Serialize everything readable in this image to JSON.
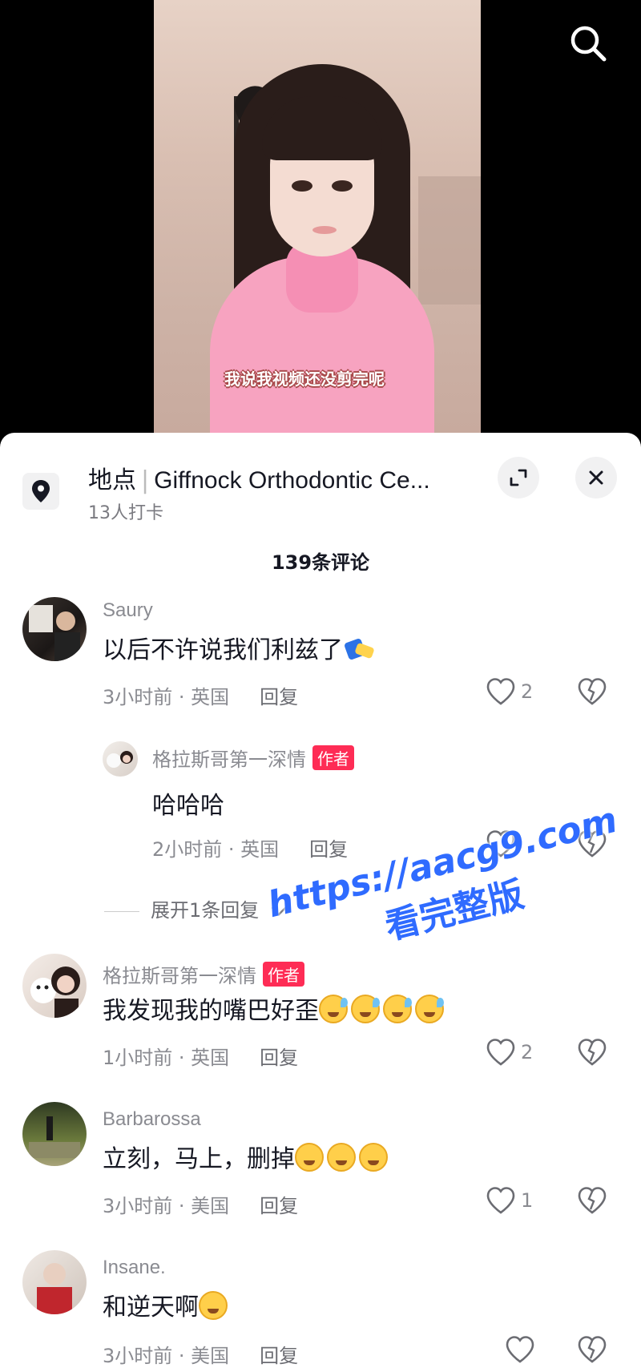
{
  "video": {
    "subtitle": "我说我视频还没剪完呢"
  },
  "location": {
    "label": "地点",
    "place": "Giffnock Orthodontic Ce...",
    "checkins": "13人打卡"
  },
  "comment_count": "139条评论",
  "comments": [
    {
      "user": "Saury",
      "text": "以后不许说我们利兹了",
      "time_region": "3小时前 · 英国",
      "reply": "回复",
      "likes": "2",
      "author": false
    },
    {
      "user": "格拉斯哥第一深情",
      "text": "我发现我的嘴巴好歪",
      "time_region": "1小时前 · 英国",
      "reply": "回复",
      "likes": "2",
      "author": true
    },
    {
      "user": "Barbarossa",
      "text": "立刻，马上，删掉",
      "time_region": "3小时前 · 美国",
      "reply": "回复",
      "likes": "1",
      "author": false
    },
    {
      "user": "Insane.",
      "text": "和逆天啊",
      "time_region": "3小时前 · 美国",
      "reply": "回复",
      "likes": "",
      "author": false
    }
  ],
  "sub_reply": {
    "user": "格拉斯哥第一深情",
    "badge": "作者",
    "text": "哈哈哈",
    "time_region": "2小时前 · 英国",
    "reply": "回复"
  },
  "expand_replies": "展开1条回复",
  "author_badge": "作者",
  "watermark": {
    "url": "https://aacg9.com",
    "text": "看完整版"
  },
  "icons": [
    "search-icon",
    "location-pin-icon",
    "expand-icon",
    "close-icon",
    "heart-icon",
    "broken-heart-icon",
    "chevron-down-icon"
  ],
  "colors": {
    "badge": "#fe2c55",
    "watermark": "#2f6bff",
    "sheet_bg": "#ffffff"
  }
}
